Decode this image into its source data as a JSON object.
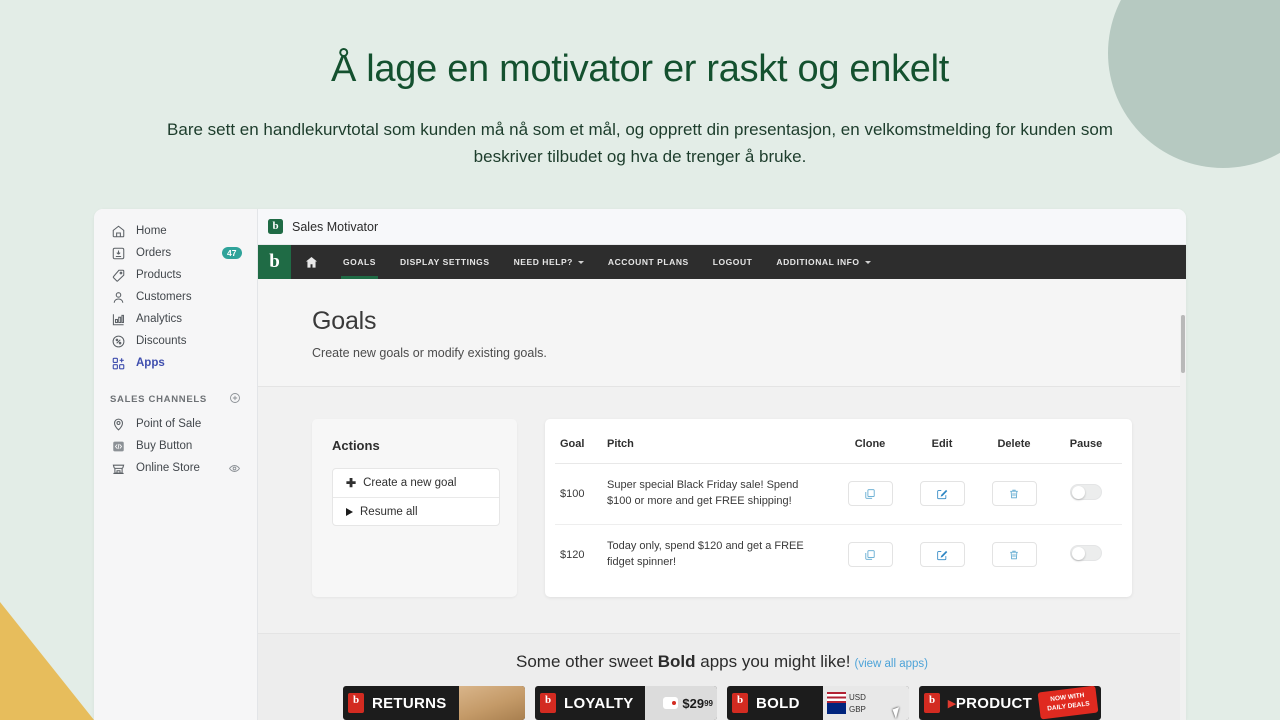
{
  "hero": {
    "headline": "Å lage en motivator er raskt og enkelt",
    "subhead": "Bare sett en handlekurvtotal som kunden må nå som et mål, og opprett din presentasjon, en velkomstmelding for kunden som beskriver tilbudet og hva de trenger å bruke.",
    "headline_color": "#14512f",
    "background_color": "#e3ede7",
    "circle_color": "#b6c9c1",
    "triangle_color": "#e7bd5c"
  },
  "sidebar": {
    "items": [
      {
        "label": "Home",
        "icon": "home-icon",
        "badge": ""
      },
      {
        "label": "Orders",
        "icon": "orders-icon",
        "badge": "47"
      },
      {
        "label": "Products",
        "icon": "products-tag-icon",
        "badge": ""
      },
      {
        "label": "Customers",
        "icon": "customers-icon",
        "badge": ""
      },
      {
        "label": "Analytics",
        "icon": "analytics-bars-icon",
        "badge": ""
      },
      {
        "label": "Discounts",
        "icon": "discounts-icon",
        "badge": ""
      },
      {
        "label": "Apps",
        "icon": "apps-grid-icon",
        "badge": ""
      }
    ],
    "section_title": "SALES CHANNELS",
    "add_channel_icon": "plus-circle-icon",
    "channels": [
      {
        "label": "Point of Sale",
        "icon": "location-pin-icon"
      },
      {
        "label": "Buy Button",
        "icon": "code-brackets-icon"
      },
      {
        "label": "Online Store",
        "icon": "storefront-icon",
        "trailing_icon": "eye-icon"
      }
    ],
    "active_item": "Apps",
    "active_color": "#3f4eae",
    "badge_color": "#2fa39a"
  },
  "app": {
    "title": "Sales Motivator",
    "logo_letter": "b",
    "logo_color": "#1f6b45",
    "nav": {
      "home_icon": "home-icon",
      "links": [
        {
          "label": "GOALS",
          "caret": false,
          "active": true
        },
        {
          "label": "DISPLAY SETTINGS",
          "caret": false,
          "active": false
        },
        {
          "label": "NEED HELP?",
          "caret": true,
          "active": false
        },
        {
          "label": "ACCOUNT PLANS",
          "caret": false,
          "active": false
        },
        {
          "label": "LOGOUT",
          "caret": false,
          "active": false
        },
        {
          "label": "ADDITIONAL INFO",
          "caret": true,
          "active": false
        }
      ]
    },
    "page": {
      "title": "Goals",
      "subtitle": "Create new goals or modify existing goals."
    },
    "actions": {
      "title": "Actions",
      "create_label": "Create a new goal",
      "create_icon": "plus-icon",
      "resume_label": "Resume all",
      "resume_icon": "play-icon"
    },
    "table": {
      "columns": [
        "Goal",
        "Pitch",
        "Clone",
        "Edit",
        "Delete",
        "Pause"
      ],
      "rows": [
        {
          "goal": "$100",
          "pitch": "Super special Black Friday sale! Spend $100 or more and get FREE shipping!",
          "clone_icon": "copy-icon",
          "edit_icon": "pencil-square-icon",
          "delete_icon": "trash-icon",
          "pause_state": "off"
        },
        {
          "goal": "$120",
          "pitch": "Today only, spend $120 and get a FREE fidget spinner!",
          "clone_icon": "copy-icon",
          "edit_icon": "pencil-square-icon",
          "delete_icon": "trash-icon",
          "pause_state": "off"
        }
      ],
      "action_icon_color": "#5ba7cf"
    },
    "promo": {
      "title_pre": "Some other sweet ",
      "title_bold": "Bold",
      "title_post": " apps you might like!",
      "link": "(view all apps)",
      "link_color": "#4da3d8",
      "cards": [
        {
          "name": "RETURNS",
          "art": "box"
        },
        {
          "name": "LOYALTY",
          "art": "price",
          "price": "$29",
          "price_cents": "99"
        },
        {
          "name": "BOLD",
          "art": "currency",
          "currency_a": "USD",
          "currency_b": "GBP"
        },
        {
          "name": "PRODUCT",
          "art": "badge",
          "badge_line1": "NOW WITH",
          "badge_line2": "DAILY DEALS"
        }
      ]
    }
  }
}
